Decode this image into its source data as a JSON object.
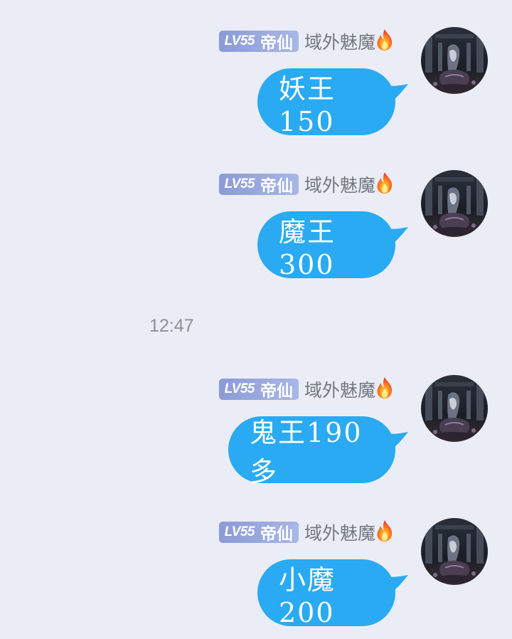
{
  "colors": {
    "background": "#eaedf5",
    "bubble": "#29aaf2",
    "badge_start": "#8a9bd6",
    "badge_end": "#a9b6e6",
    "nickname": "#737880",
    "timestamp": "#8c9097"
  },
  "timestamp": "12:47",
  "messages": [
    {
      "sender": {
        "level": "LV55",
        "title": "帝仙",
        "nickname": "域外魅魔",
        "badge_icon": "fire-icon",
        "avatar": "avatar"
      },
      "text": "妖王150"
    },
    {
      "sender": {
        "level": "LV55",
        "title": "帝仙",
        "nickname": "域外魅魔",
        "badge_icon": "fire-icon",
        "avatar": "avatar"
      },
      "text": "魔王300"
    },
    {
      "sender": {
        "level": "LV55",
        "title": "帝仙",
        "nickname": "域外魅魔",
        "badge_icon": "fire-icon",
        "avatar": "avatar"
      },
      "text": "鬼王190多"
    },
    {
      "sender": {
        "level": "LV55",
        "title": "帝仙",
        "nickname": "域外魅魔",
        "badge_icon": "fire-icon",
        "avatar": "avatar"
      },
      "text": "小魔200"
    }
  ]
}
